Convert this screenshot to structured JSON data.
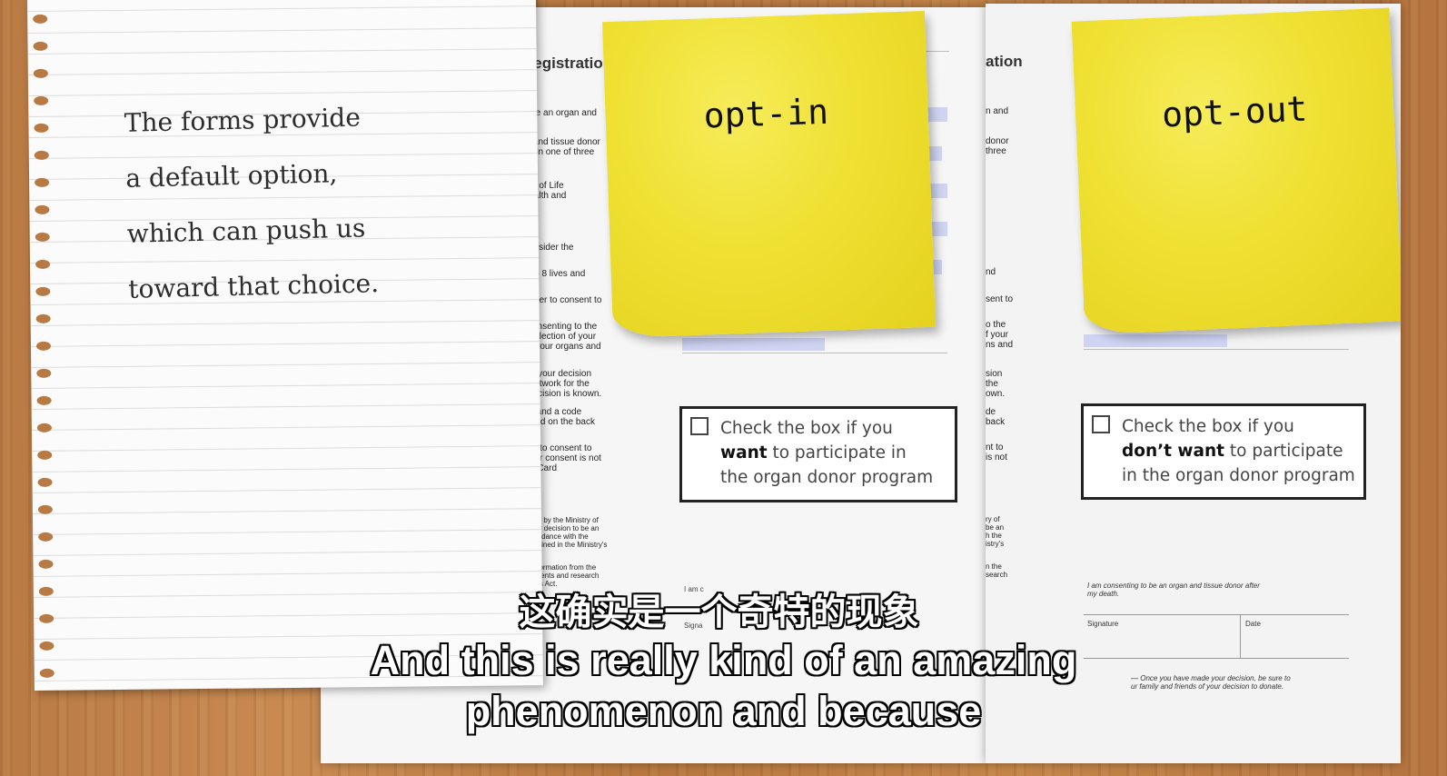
{
  "notebook": {
    "lines": [
      "The forms provide",
      "a default option,",
      "which can push us",
      "toward that choice."
    ]
  },
  "form_left": {
    "title": "Registration",
    "fragments": [
      "to be an organ and",
      "an and tissue donor\nare in one of three",
      "Gift of Life\nHealth and",
      "consider the",
      "p to 8 lives and",
      "order to consent to",
      "consenting to the\ncollection of your\ne your organs and",
      "ut your decision\nNetwork for the\ndecision is known.",
      "r\" and a code\nnted on the back",
      "ot to consent to\nour consent is not\nh Card"
    ],
    "small_fragments": [
      "ted by the Ministry of\nour decision to be an\ncordance with the\nntained in the Ministry's",
      "information from the\nsidents and research\nnes Act."
    ],
    "sticky_label": "opt-in",
    "checkbox_line1": "Check the box if you",
    "checkbox_emphasis": "want",
    "checkbox_line2_rest": " to participate in",
    "checkbox_line3": "the organ donor program"
  },
  "form_right": {
    "title": "ation",
    "fragments": [
      "n and",
      "donor\nthree",
      "nd",
      "sent to",
      "o the\nf your\nns and",
      "sion\nthe\nown.",
      "de\nback",
      "nt to\nis not"
    ],
    "small_fragments": [
      "ry of\nbe an\nh the\nistry's",
      "n the\nsearch"
    ],
    "consent_text": "I am consenting to be an organ and tissue donor after\nmy death.",
    "signature_label": "Signature",
    "date_label": "Date",
    "footer_text": "— Once you have made your decision, be sure to\nur family and friends of your decision to donate.",
    "sticky_label": "opt-out",
    "checkbox_line1": "Check the box if you",
    "checkbox_emphasis": "don’t want",
    "checkbox_line2_rest": " to participate",
    "checkbox_line3": "in the organ donor program"
  },
  "subtitles": {
    "chinese": "这确实是一个奇特的现象",
    "english_line1": "And this is really kind of an amazing",
    "english_line2": "phenomenon and because"
  }
}
